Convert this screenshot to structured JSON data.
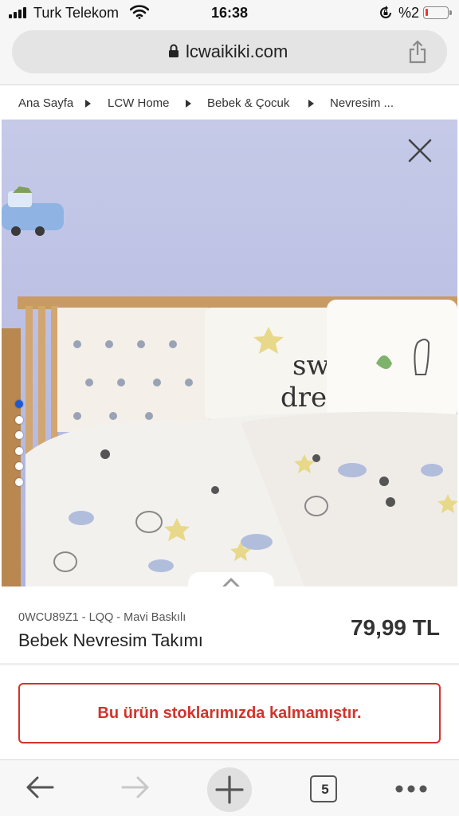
{
  "status_bar": {
    "carrier": "Turk Telekom",
    "time": "16:38",
    "battery_percent": "%2"
  },
  "browser": {
    "url": "lcwaikiki.com",
    "open_tabs": "5"
  },
  "breadcrumb": [
    "Ana Sayfa",
    "LCW Home",
    "Bebek & Çocuk",
    "Nevresim ..."
  ],
  "carousel": {
    "image_count": 6,
    "active_index": 0
  },
  "product": {
    "code": "0WCU89Z1 - LQQ - Mavi Baskılı",
    "name": "Bebek Nevresim Takımı",
    "price": "79,99 TL"
  },
  "stock_notice": "Bu ürün stoklarımızda kalmamıştır.",
  "colors": {
    "alert_red": "#d0342c",
    "active_dot": "#1e5ad2",
    "wall": "#b9bfe6"
  }
}
